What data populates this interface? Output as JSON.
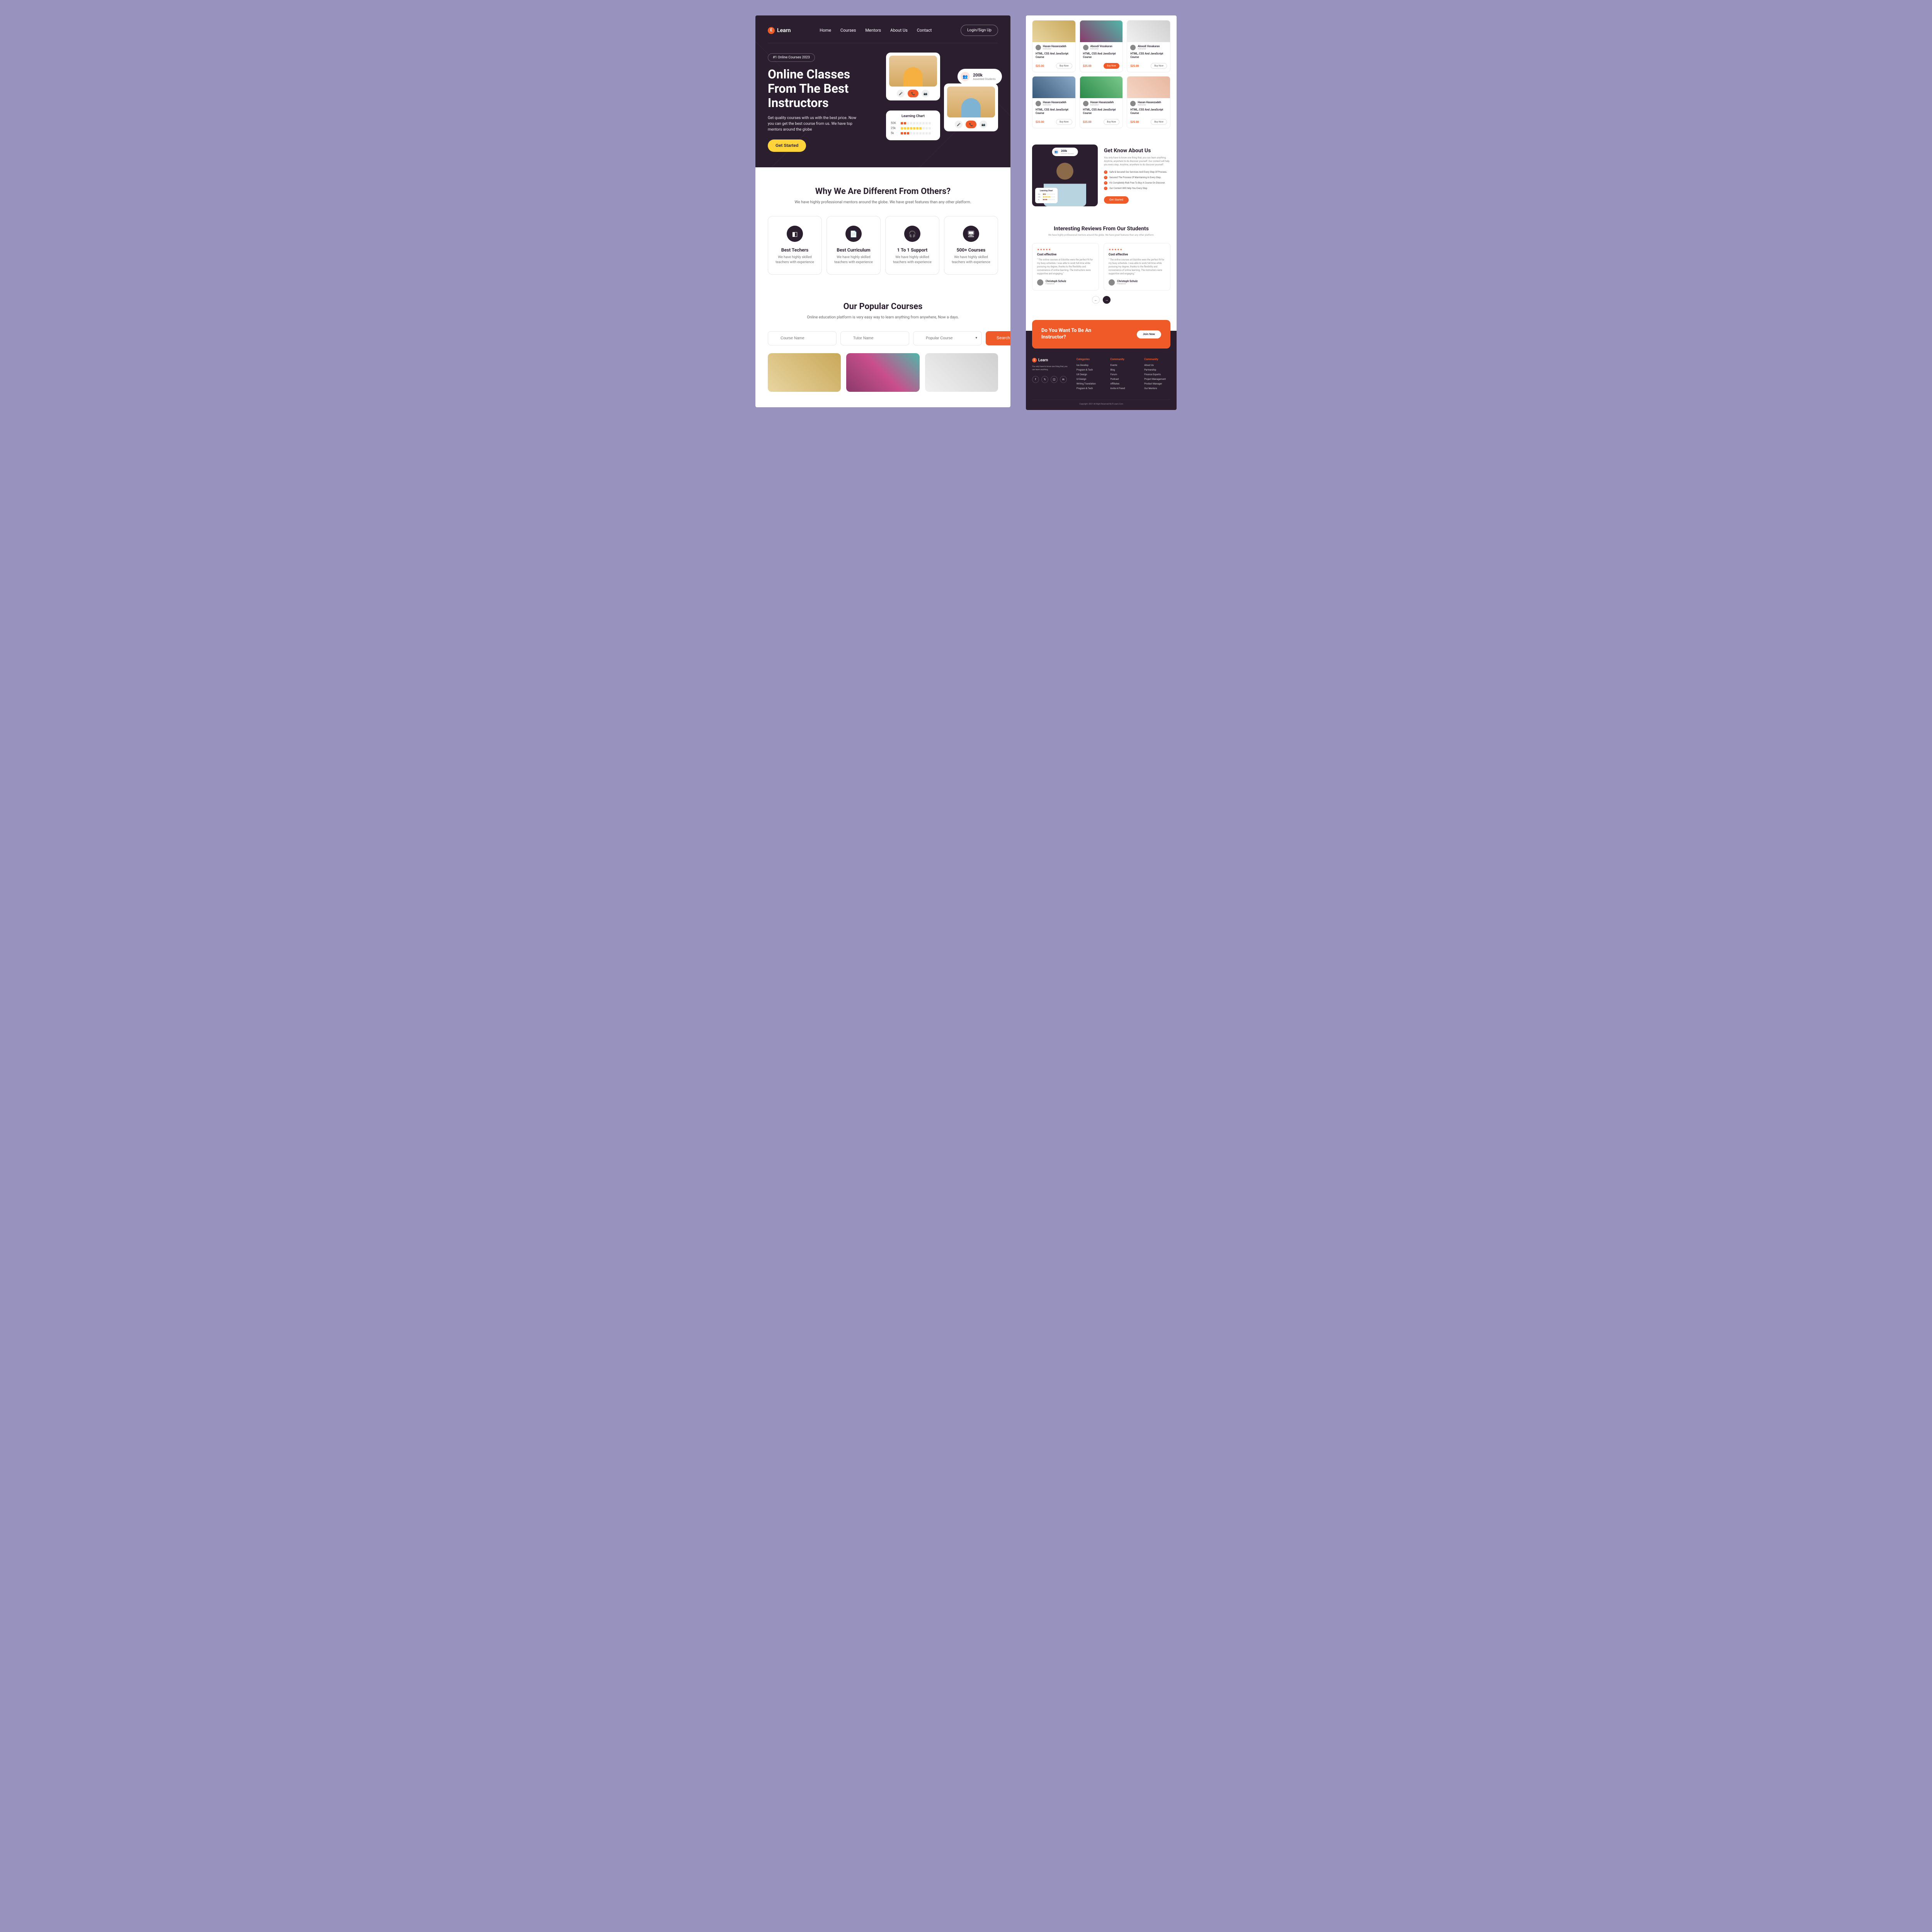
{
  "brand": "Learn",
  "nav": [
    "Home",
    "Courses",
    "Mentors",
    "About Us",
    "Contact"
  ],
  "login": "Login/Sign Up",
  "hero": {
    "badge": "#1 Online Courses 2023",
    "title": "Online Classes From The Best Instructors",
    "sub": "Get quality courses with us with the best price. Now you can get the best course from us. We have top mentors around the globe",
    "cta": "Get Started",
    "stat_n": "200k",
    "stat_l": "Assented Students",
    "chart_title": "Learning Chart",
    "chart_rows": [
      "50K",
      "25k",
      "5k"
    ]
  },
  "why": {
    "title": "Why We Are Different From Others?",
    "sub": "We have highly professional mentors around the globe. We have great features than any other platform.",
    "features": [
      {
        "icon": "◧",
        "title": "Best Techers",
        "txt": "We have highly skilled teachers with experience"
      },
      {
        "icon": "📄",
        "title": "Best Curriculum",
        "txt": "We have highly skilled teachers with experience"
      },
      {
        "icon": "🎧",
        "title": "1 To 1 Support",
        "txt": "We have highly skilled teachers with experience"
      },
      {
        "icon": "🖥",
        "title": "500+ Courses",
        "txt": "We have highly skilled teachers with experience"
      }
    ]
  },
  "popular": {
    "title": "Our Popular Courses",
    "sub": "Online education platform is very easy way to learn anything from anywhere, Now a days.",
    "ph_course": "Course Name",
    "ph_tutor": "Tutor Name",
    "ph_pop": "Popular Course",
    "search": "Search"
  },
  "rcourses": [
    {
      "img": "ri1",
      "author": "Hasan Hasanzadeh",
      "role": "Instructor",
      "title": "HTML, CSS And JavaScript Course",
      "price": "$25.00",
      "active": false
    },
    {
      "img": "ri2",
      "author": "Aboodi Vesakaran",
      "role": "Instructor",
      "title": "HTML, CSS And JavaScript Course",
      "price": "$25.00",
      "active": true
    },
    {
      "img": "ri3",
      "author": "Aboodi Vesakaran",
      "role": "Instructor",
      "title": "HTML, CSS And JavaScript Course",
      "price": "$25.00",
      "active": false
    },
    {
      "img": "ri4",
      "author": "Hasan Hasanzadeh",
      "role": "Instructor",
      "title": "HTML, CSS And JavaScript Course",
      "price": "$25.00",
      "active": false
    },
    {
      "img": "ri5",
      "author": "Hasan Hasanzadeh",
      "role": "Instructor",
      "title": "HTML, CSS And JavaScript Course",
      "price": "$25.00",
      "active": false
    },
    {
      "img": "ri6",
      "author": "Hasan Hasanzadeh",
      "role": "Instructor",
      "title": "HTML, CSS And JavaScript Course",
      "price": "$25.00",
      "active": false
    }
  ],
  "buy_label": "Buy Now",
  "about": {
    "title": "Get Know About Us",
    "sub": "You only have to know one thing that, you can learn anything. Anytime, anywhere to do discover yourself. Our content will help you every step. Anytime, anywhere to do discover yourself.",
    "list": [
      "Safe & Secured Our Services And Every Step Of Process.",
      "Secured The Process Of Maintaining In Every Step.",
      "It's Completely Risk Free To Buy A Course On Discover.",
      "Our Content Will Help You Every Step"
    ],
    "cta": "Get Started",
    "stat_n": "200k",
    "stat_l": "Assented Students",
    "chart_title": "Learning Chart",
    "chart_rows": [
      "50k",
      "25k",
      "5k"
    ]
  },
  "reviews": {
    "title": "Interesting Reviews From Our Students",
    "sub": "We have highly professional mentors around the globe. We have great features than any other platform.",
    "cards": [
      {
        "ct": "Cost effective",
        "body": "\" The online courses at EduVibe were the perfect fit for my busy schedule. I was able to work full-time while pursuing my degree, thanks to the flexibility and convenience of online learning. The instructors were supportive and engaging.\"",
        "name": "Christoph Schulz",
        "role": "Freelancer"
      },
      {
        "ct": "Cost effective",
        "body": "\" The online courses at EduVibe were the perfect fit for my busy schedule. I was able to work full-time while pursuing my degree, thanks to the flexibility and convenience of online learning. The instructors were supportive and engaging.\"",
        "name": "Christoph Schulz",
        "role": "Freelancer"
      }
    ]
  },
  "cta_banner": {
    "title": "Do You Want To Be An Instructor?",
    "btn": "Join Now"
  },
  "footer": {
    "desc": "You only have to know one thing that, you can learn anything.",
    "cols": [
      {
        "h": "Categories",
        "items": [
          "Ios Develop",
          "Program & Tech",
          "UX Design",
          "UI Design",
          "Writing Translation",
          "Program & Tech"
        ]
      },
      {
        "h": "Community",
        "items": [
          "Events",
          "Blog",
          "Forum",
          "Podcast",
          "Affiliates",
          "Invite A Friend"
        ]
      },
      {
        "h": "Community",
        "items": [
          "About Us",
          "Partnership",
          "Finance Experts",
          "Project Management",
          "Product Manager",
          "Our Mentors"
        ]
      }
    ],
    "copy": "Copyright- 2021 All Right Reserved By E-Learn.Com"
  }
}
